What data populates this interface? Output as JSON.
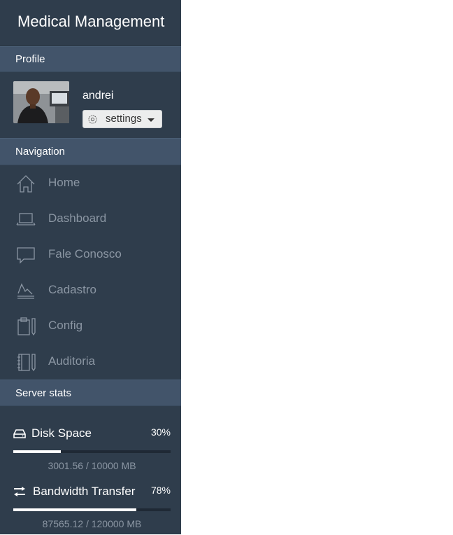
{
  "app": {
    "title": "Medical Management"
  },
  "profile": {
    "section_label": "Profile",
    "username": "andrei",
    "settings_label": "settings"
  },
  "navigation": {
    "section_label": "Navigation",
    "items": [
      {
        "label": "Home",
        "icon": "home-icon"
      },
      {
        "label": "Dashboard",
        "icon": "laptop-icon"
      },
      {
        "label": "Fale Conosco",
        "icon": "chat-icon"
      },
      {
        "label": "Cadastro",
        "icon": "chart-line-icon"
      },
      {
        "label": "Config",
        "icon": "clipboard-pencil-icon"
      },
      {
        "label": "Auditoria",
        "icon": "notebook-pencil-icon"
      }
    ]
  },
  "server_stats": {
    "section_label": "Server stats",
    "items": [
      {
        "name": "Disk Space",
        "icon": "hard-drive-icon",
        "percent_label": "30%",
        "percent": 30,
        "detail": "3001.56 / 10000 MB"
      },
      {
        "name": "Bandwidth Transfer",
        "icon": "transfer-arrows-icon",
        "percent_label": "78%",
        "percent": 78,
        "detail": "87565.12 / 120000 MB"
      }
    ]
  },
  "colors": {
    "sidebar_bg": "#2f3d4c",
    "section_header_bg": "#42546a",
    "nav_text": "#8b96a3",
    "progress_fill": "#ffffff",
    "progress_track": "#1f2935"
  }
}
